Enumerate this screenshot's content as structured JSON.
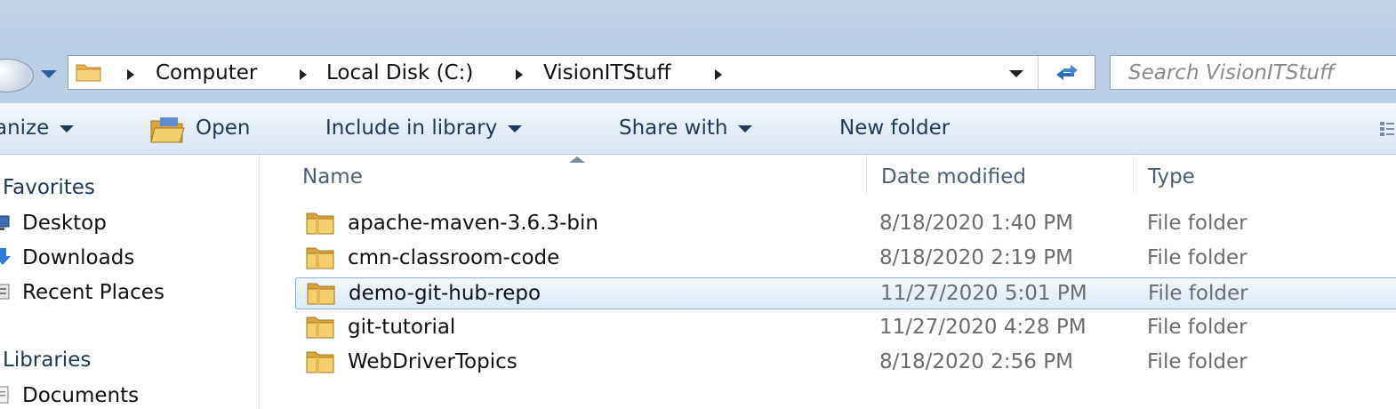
{
  "breadcrumb": [
    "Computer",
    "Local Disk (C:)",
    "VisionITStuff"
  ],
  "search": {
    "placeholder": "Search VisionITStuff"
  },
  "toolbar": {
    "organize": "anize",
    "open": "Open",
    "include_in_library": "Include in library",
    "share_with": "Share with",
    "new_folder": "New folder"
  },
  "nav": {
    "favorites": "Favorites",
    "favorites_items": [
      "Desktop",
      "Downloads",
      "Recent Places"
    ],
    "libraries": "Libraries",
    "libraries_items": [
      "Documents"
    ]
  },
  "columns": {
    "name": "Name",
    "date": "Date modified",
    "type": "Type"
  },
  "files": [
    {
      "name": "apache-maven-3.6.3-bin",
      "date": "8/18/2020 1:40 PM",
      "type": "File folder"
    },
    {
      "name": "cmn-classroom-code",
      "date": "8/18/2020 2:19 PM",
      "type": "File folder"
    },
    {
      "name": "demo-git-hub-repo",
      "date": "11/27/2020 5:01 PM",
      "type": "File folder"
    },
    {
      "name": "git-tutorial",
      "date": "11/27/2020 4:28 PM",
      "type": "File folder"
    },
    {
      "name": "WebDriverTopics",
      "date": "8/18/2020 2:56 PM",
      "type": "File folder"
    }
  ],
  "selected_file": "demo-git-hub-repo",
  "icons": [
    "back-button-icon",
    "recent-pages-icon",
    "folder-icon",
    "refresh-icon",
    "open-folder-icon",
    "view-options-icon",
    "desktop-icon",
    "downloads-icon",
    "recent-places-icon",
    "documents-icon"
  ],
  "colors": {
    "selection_border": "#84acdd",
    "toolbar_text": "#1e395b",
    "chrome": "#bfd2e7"
  }
}
